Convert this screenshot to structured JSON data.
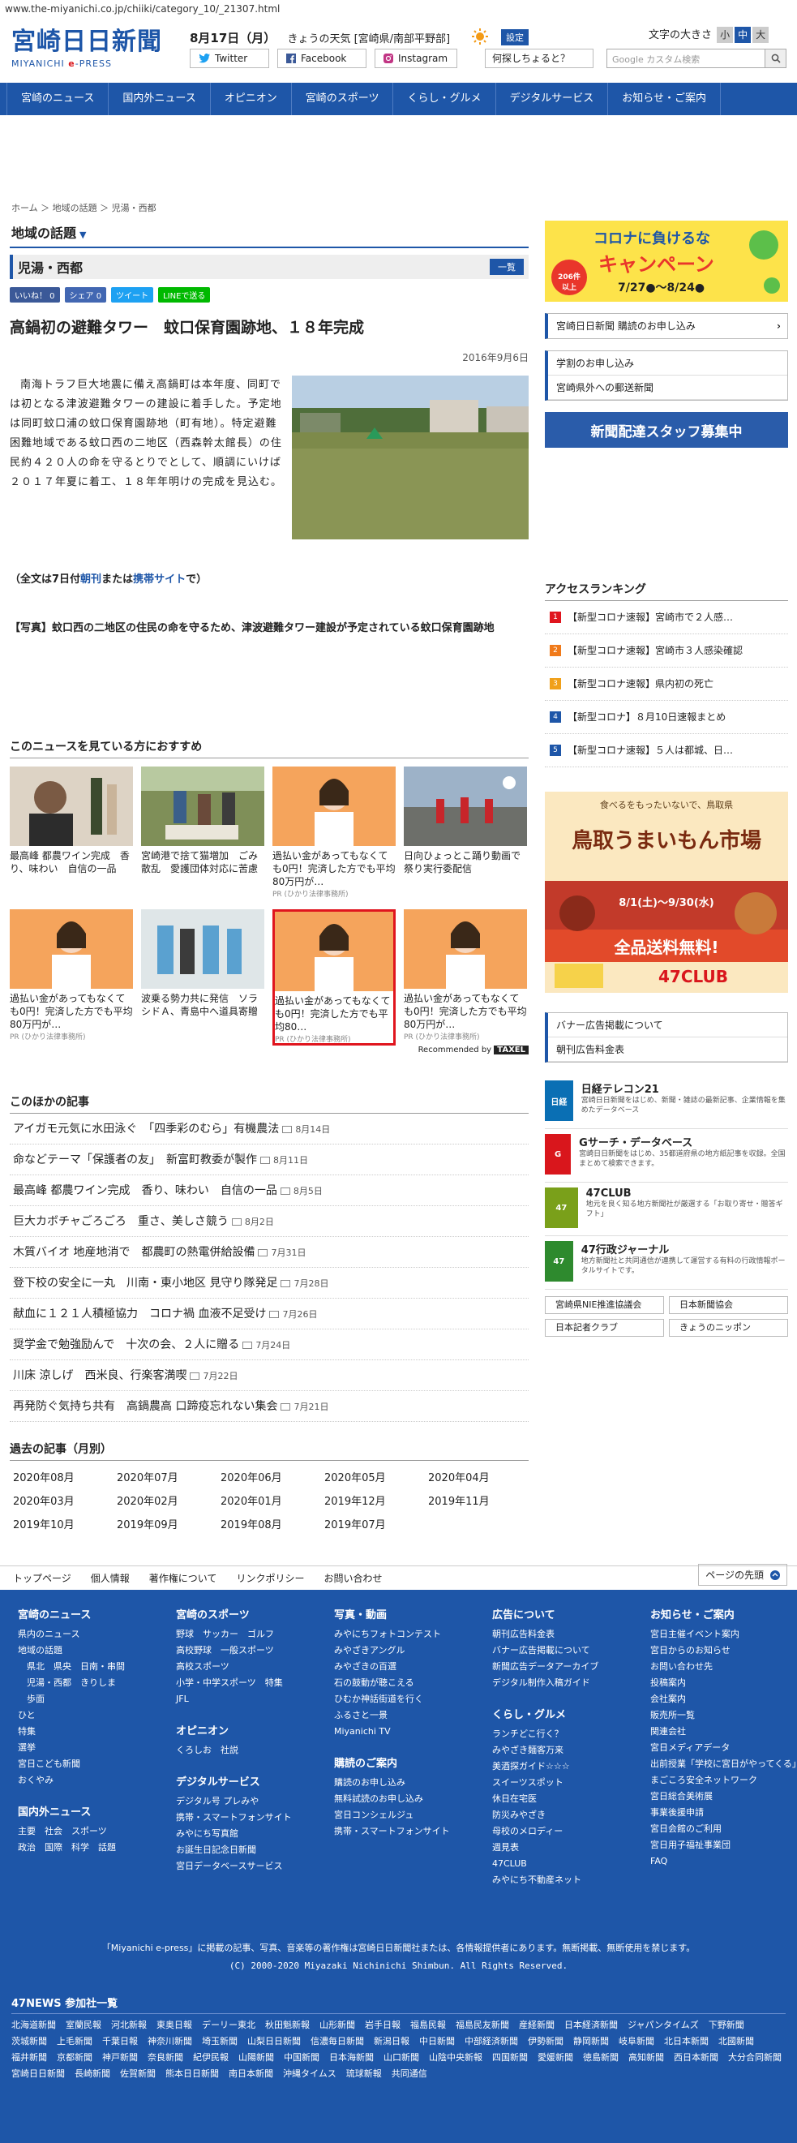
{
  "url": "www.the-miyanichi.co.jp/chiiki/category_10/_21307.html",
  "header": {
    "logo": "宮崎日日新聞",
    "logo_sub_pre": "MIYANICHI ",
    "logo_sub_e": "e",
    "logo_sub_post": "-PRESS",
    "date": "8月17日（月）",
    "weather": "きょうの天気 [宮崎県/南部平野部]",
    "settings": "設定",
    "fontsize_label": "文字の大きさ",
    "fontsize_options": [
      "小",
      "中",
      "大"
    ],
    "twitter": "Twitter",
    "facebook": "Facebook",
    "instagram": "Instagram",
    "ask": "何探しちょると？",
    "search_placeholder": "Google カスタム検索"
  },
  "nav": [
    "宮崎のニュース",
    "国内外ニュース",
    "オピニオン",
    "宮崎のスポーツ",
    "くらし・グルメ",
    "デジタルサービス",
    "お知らせ・ご案内"
  ],
  "breadcrumb": "ホーム ＞ 地域の話題 ＞ 児湯・西都",
  "main": {
    "section": "地域の話題",
    "category": "児湯・西都",
    "list_btn": "一覧",
    "share": [
      "いいね！ 0",
      "シェア 0",
      "ツイート",
      "LINEで送る"
    ],
    "headline": "高鍋初の避難タワー　蚊口保育園跡地、１８年完成",
    "pubdate": "2016年9月6日",
    "body": "南海トラフ巨大地震に備え高鍋町は本年度、同町では初となる津波避難タワーの建設に着手した。予定地は同町蚊口浦の蚊口保育園跡地（町有地）。特定避難困難地域である蚊口西の二地区（西森幹太館長）の住民約４２０人の命を守るとりでとして、順調にいけば２０１７年夏に着工、１８年年明けの完成を見込む。",
    "fulltext_pre": "（全文は7日付",
    "fulltext_l1": "朝刊",
    "fulltext_mid": "または",
    "fulltext_l2": "携帯サイト",
    "fulltext_post": "で）",
    "caption": "【写真】蚊口西の二地区の住民の命を守るため、津波避難タワー建設が予定されている蚊口保育園跡地"
  },
  "recommend": {
    "title": "このニュースを見ている方におすすめ",
    "items": [
      {
        "text": "最高峰 都農ワイン完成　香り、味わい　自信の一品",
        "pr": ""
      },
      {
        "text": "宮崎港で捨て猫増加　ごみ散乱　愛護団体対応に苦慮",
        "pr": ""
      },
      {
        "text": "過払い金があってもなくても0円！完済した方でも平均80万円が…",
        "pr": "PR (ひかり法律事務所)"
      },
      {
        "text": "日向ひょっとこ踊り動画で　祭り実行委配信",
        "pr": ""
      },
      {
        "text": "過払い金があってもなくても0円！完済した方でも平均80万円が…",
        "pr": "PR (ひかり法律事務所)"
      },
      {
        "text": "波乗る勢力共に発信　ソラシドＡ、青島中へ道具寄贈",
        "pr": ""
      },
      {
        "text": "過払い金があってもなくても0円！完済した方でも平均80…",
        "pr": "PR (ひかり法律事務所)"
      },
      {
        "text": "過払い金があってもなくても0円！完済した方でも平均80万円が…",
        "pr": "PR (ひかり法律事務所)"
      }
    ],
    "by": "Recommended by",
    "brand": "TAXEL"
  },
  "others": {
    "title": "このほかの記事",
    "rows": [
      {
        "t": "アイガモ元気に水田泳ぐ　「四季彩のむら」有機農法",
        "d": "8月14日"
      },
      {
        "t": "命などテーマ「保護者の友」　新富町教委が製作",
        "d": "8月11日"
      },
      {
        "t": "最高峰 都農ワイン完成　香り、味わい　自信の一品",
        "d": "8月5日"
      },
      {
        "t": "巨大カボチャごろごろ　重さ、美しさ競う",
        "d": "8月2日"
      },
      {
        "t": "木質バイオ 地産地消で　都農町の熱電併給設備",
        "d": "7月31日"
      },
      {
        "t": "登下校の安全に一丸　川南・東小地区 見守り隊発足",
        "d": "7月28日"
      },
      {
        "t": "献血に１２１人積極協力　コロナ禍 血液不足受け",
        "d": "7月26日"
      },
      {
        "t": "奨学金で勉強励んで　十次の会、２人に贈る",
        "d": "7月24日"
      },
      {
        "t": "川床 涼しげ　西米良、行楽客満喫",
        "d": "7月22日"
      },
      {
        "t": "再発防ぐ気持ち共有　高鍋農高 口蹄疫忘れない集会",
        "d": "7月21日"
      }
    ]
  },
  "past": {
    "title": "過去の記事（月別）",
    "months": [
      "2020年08月",
      "2020年07月",
      "2020年06月",
      "2020年05月",
      "2020年04月",
      "2020年03月",
      "2020年02月",
      "2020年01月",
      "2019年12月",
      "2019年11月",
      "2019年10月",
      "2019年09月",
      "2019年08月",
      "2019年07月"
    ]
  },
  "side": {
    "corona_title": "コロナに負けるな",
    "corona_sub": "キャンペーン",
    "corona_date": "7/27●～8/24●",
    "corona_badge": "206件以上",
    "subscribe": "宮崎日日新聞 購読のお申し込み",
    "group": [
      "学割のお申し込み",
      "宮崎県外への郵送新聞"
    ],
    "staff": "新聞配達スタッフ募集中",
    "rank_title": "アクセスランキング",
    "ranking": [
      "【新型コロナ速報】宮崎市で２人感…",
      "【新型コロナ速報】宮崎市３人感染確認",
      "【新型コロナ速報】県内初の死亡",
      "【新型コロナ】８月10日速報まとめ",
      "【新型コロナ速報】５人は都城、日…"
    ],
    "rank_colors": [
      "#e0151e",
      "#f07a1a",
      "#f0a01a",
      "#1e56a8",
      "#1e56a8"
    ],
    "tottori_top": "食べるをもったいないで、鳥取県",
    "tottori_main": "鳥取うまいもん市場",
    "tottori_date": "8/1(土)～9/30(水)",
    "tottori_free": "全品送料無料!",
    "tottori_club": "47CLUB",
    "links": [
      "バナー広告掲載について",
      "朝刊広告料金表"
    ],
    "services": [
      {
        "name": "日経テレコン21",
        "desc": "宮崎日日新聞をはじめ、新聞・雑誌の最新記事、企業情報を集めたデータベース",
        "logo": "日経",
        "color": "#0a6fb4"
      },
      {
        "name": "Gサーチ・データベース",
        "desc": "宮崎日日新聞をはじめ、35都道府県の地方紙記事を収録。全国まとめて検索できます。",
        "logo": "G",
        "color": "#d9161c"
      },
      {
        "name": "47CLUB",
        "desc": "地元を良く知る地方新聞社が厳選する「お取り寄せ・贈答ギフト」",
        "logo": "47",
        "color": "#7aa01a"
      },
      {
        "name": "47行政ジャーナル",
        "desc": "地方新聞社と共同通信が連携して運営する有料の行政情報ポータルサイトです。",
        "logo": "47",
        "color": "#2e8a2e"
      }
    ],
    "mini": [
      "宮崎県NIE推進協議会",
      "日本新聞協会",
      "日本記者クラブ",
      "きょうのニッポン"
    ]
  },
  "footer": {
    "links": [
      "トップページ",
      "個人情報",
      "著作権について",
      "リンクポリシー",
      "お問い合わせ"
    ],
    "pagetop": "ページの先頭",
    "cols": [
      {
        "h": "宮崎のニュース",
        "l": [
          "県内のニュース",
          "地域の話題",
          "　県北　県央　日南・串間",
          "　児湯・西都　きりしま",
          "　歩面",
          "ひと",
          "特集",
          "選挙",
          "宮日こども新聞",
          "おくやみ"
        ],
        "h2": "国内外ニュース",
        "l2": [
          "主要　社会　スポーツ",
          "政治　国際　科学　話題"
        ]
      },
      {
        "h": "宮崎のスポーツ",
        "l": [
          "野球　サッカー　ゴルフ",
          "高校野球　一般スポーツ",
          "高校スポーツ",
          "小学・中学スポーツ　特集",
          "JFL"
        ],
        "h2": "オピニオン",
        "l2": [
          "くろしお　社説"
        ],
        "h3": "デジタルサービス",
        "l3": [
          "デジタル号 プレみや",
          "携帯・スマートフォンサイト",
          "みやにち写真館",
          "お誕生日記念日新聞",
          "宮日データベースサービス"
        ]
      },
      {
        "h": "写真・動画",
        "l": [
          "みやにちフォトコンテスト",
          "みやざきアングル",
          "みやざきの百選",
          "石の鼓動が聴こえる",
          "ひむか神話街道を行く",
          "ふるさと一景",
          "Miyanichi TV"
        ],
        "h2": "購読のご案内",
        "l2": [
          "購読のお申し込み",
          "無料試読のお申し込み",
          "宮日コンシェルジュ",
          "携帯・スマートフォンサイト"
        ]
      },
      {
        "h": "広告について",
        "l": [
          "朝刊広告料金表",
          "バナー広告掲載について",
          "新聞広告データアーカイブ",
          "デジタル制作入稿ガイド"
        ],
        "h2": "くらし・グルメ",
        "l2": [
          "ランチどこ行く？",
          "みやざき麺客万来",
          "美酒探ガイド☆☆☆",
          "スイーツスポット",
          "休日在宅医",
          "防災みやざき",
          "母校のメロディー",
          "週見表",
          "47CLUB",
          "みやにち不動産ネット"
        ]
      },
      {
        "h": "お知らせ・ご案内",
        "l": [
          "宮日主催イベント案内",
          "宮日からのお知らせ",
          "お問い合わせ先",
          "投稿案内",
          "会社案内",
          "販売所一覧",
          "関連会社",
          "宮日メディアデータ",
          "出前授業「学校に宮日がやってくる」",
          "まごころ安全ネットワーク",
          "宮日総合美術展",
          "事業後援申請",
          "宮日会館のご利用",
          "宮日用子福祉事業団",
          "FAQ"
        ]
      }
    ],
    "copy1": "「Miyanichi e-press」に掲載の記事、写真、音楽等の著作権は宮崎日日新聞社または、各情報提供者にあります。無断掲載、無断使用を禁じます。",
    "copy2": "(C) 2000-2020 Miyazaki Nichinichi Shimbun. All Rights Reserved.",
    "news47_title": "47NEWS 参加社一覧",
    "papers": [
      "北海道新聞",
      "室蘭民報",
      "河北新報",
      "東奥日報",
      "デーリー東北",
      "秋田魁新報",
      "山形新聞",
      "岩手日報",
      "福島民報",
      "福島民友新聞",
      "産経新聞",
      "日本経済新聞",
      "ジャパンタイムズ",
      "下野新聞",
      "茨城新聞",
      "上毛新聞",
      "千葉日報",
      "神奈川新聞",
      "埼玉新聞",
      "山梨日日新聞",
      "信濃毎日新聞",
      "新潟日報",
      "中日新聞",
      "中部経済新聞",
      "伊勢新聞",
      "静岡新聞",
      "岐阜新聞",
      "北日本新聞",
      "北國新聞",
      "福井新聞",
      "京都新聞",
      "神戸新聞",
      "奈良新聞",
      "紀伊民報",
      "山陽新聞",
      "中国新聞",
      "日本海新聞",
      "山口新聞",
      "山陰中央新報",
      "四国新聞",
      "愛媛新聞",
      "徳島新聞",
      "高知新聞",
      "西日本新聞",
      "大分合同新聞",
      "宮崎日日新聞",
      "長崎新聞",
      "佐賀新聞",
      "熊本日日新聞",
      "南日本新聞",
      "沖縄タイムス",
      "琉球新報",
      "共同通信"
    ]
  }
}
